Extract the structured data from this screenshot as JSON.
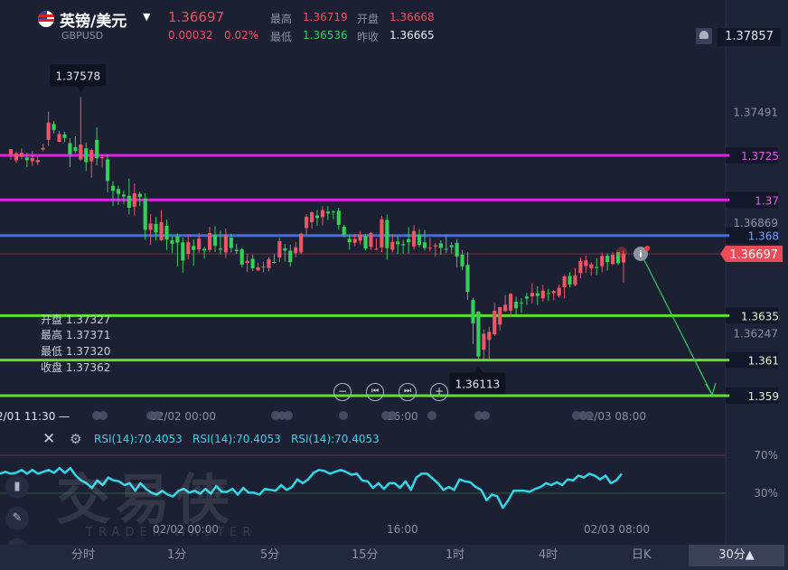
{
  "header": {
    "title": "英镑/美元",
    "symbol": "GBPUSD",
    "price": "1.36697",
    "change": "0.00032",
    "change_pct": "0.02%",
    "stats": {
      "high_label": "最高",
      "high": "1.36719",
      "open_label": "开盘",
      "open": "1.36668",
      "low_label": "最低",
      "low": "1.36536",
      "prev_label": "昨收",
      "prev": "1.36665"
    },
    "right_price": "1.37857"
  },
  "hover": {
    "open": "开盘 1.37327",
    "high": "最高 1.37371",
    "low": "最低 1.37320",
    "close": "收盘 1.37362"
  },
  "nav": {
    "zoom_out": "−",
    "prev": "⏮",
    "next": "⏭",
    "zoom_in": "+"
  },
  "rsi_labels": [
    "RSI(14):70.4053",
    "RSI(14):70.4053",
    "RSI(14):70.4053"
  ],
  "watermark": {
    "cn": "交易侠",
    "en": "TRADER MASTER"
  },
  "timeframes": [
    "分时",
    "1分",
    "5分",
    "15分",
    "1时",
    "4时",
    "日K"
  ],
  "timeframe_selected": "30分▲",
  "icons": {
    "header": [
      "uk-flag-icon",
      "caret-down-icon",
      "bell-icon"
    ],
    "rsi": [
      "close-icon",
      "gear-icon"
    ],
    "side": [
      "candles-icon",
      "pencil-icon",
      "waves-icon"
    ]
  },
  "colors": {
    "up": "#ef5566",
    "down": "#2fd256",
    "magenta": "#e21fe6",
    "blue": "#3a6ff0",
    "green": "#5ee02b",
    "rsi": "#2fd7e8"
  },
  "chart_data": {
    "type": "candlestick",
    "y_axis_ticks": [
      "1.37491",
      "1.36869",
      "1.36247"
    ],
    "y_range": [
      1.3589,
      1.3792
    ],
    "last_price": "1.36697",
    "max_label": "1.37578",
    "min_label": "1.36113",
    "levels": [
      {
        "value": 1.3725,
        "label": "1.3725",
        "color": "magenta"
      },
      {
        "value": 1.37,
        "label": "1.37",
        "color": "magenta"
      },
      {
        "value": 1.368,
        "label": "1.368",
        "color": "blue"
      },
      {
        "value": 1.3635,
        "label": "1.3635",
        "color": "green"
      },
      {
        "value": 1.361,
        "label": "1.361",
        "color": "green"
      },
      {
        "value": 1.359,
        "label": "1.359",
        "color": "green"
      }
    ],
    "x_labels": [
      "2/01 11:30 —",
      "02/02 00:00",
      "16:00",
      "02/03 08:00"
    ],
    "rsi": {
      "levels": [
        "70%",
        "30%"
      ],
      "x_labels": [
        "02/02 00:00",
        "16:00",
        "02/03 08:00"
      ],
      "values": [
        62,
        64,
        62,
        63,
        66,
        62,
        66,
        62,
        64,
        66,
        63,
        68,
        63,
        68,
        60,
        55,
        52,
        47,
        55,
        50,
        58,
        55,
        54,
        50,
        52,
        44,
        52,
        46,
        42,
        40,
        44,
        40,
        38,
        44,
        46,
        42,
        44,
        41,
        46,
        41,
        49,
        43,
        43,
        46,
        40,
        47,
        42,
        42,
        40,
        46,
        45,
        44,
        50,
        45,
        48,
        56,
        52,
        56,
        63,
        66,
        65,
        62,
        64,
        66,
        64,
        61,
        62,
        55,
        54,
        47,
        52,
        46,
        52,
        52,
        47,
        54,
        45,
        58,
        62,
        62,
        57,
        52,
        45,
        48,
        45,
        56,
        54,
        53,
        48,
        45,
        34,
        40,
        38,
        26,
        34,
        44,
        44,
        44,
        43,
        46,
        48,
        52,
        50,
        53,
        50,
        56,
        55,
        60,
        58,
        62,
        60,
        56,
        60,
        52,
        55,
        62
      ]
    },
    "candles": [
      [
        1.37254,
        1.37285,
        1.37246,
        1.37227
      ],
      [
        1.37222,
        1.37262,
        1.37271,
        1.37206
      ],
      [
        1.37242,
        1.37264,
        1.37289,
        1.37229
      ],
      [
        1.37238,
        1.37223,
        1.37265,
        1.37184
      ],
      [
        1.37217,
        1.37235,
        1.37274,
        1.37191
      ],
      [
        1.37212,
        1.37224,
        1.37248,
        1.37196
      ],
      [
        1.37283,
        1.37292,
        1.37316,
        1.37274
      ],
      [
        1.37337,
        1.37434,
        1.37495,
        1.37303
      ],
      [
        1.37426,
        1.37393,
        1.37444,
        1.37373
      ],
      [
        1.37326,
        1.3737,
        1.37387,
        1.37324
      ],
      [
        1.37368,
        1.37348,
        1.37384,
        1.37325
      ],
      [
        1.37319,
        1.37256,
        1.37346,
        1.37185
      ],
      [
        1.37296,
        1.37276,
        1.37357,
        1.37262
      ],
      [
        1.37227,
        1.37311,
        1.37578,
        1.37219
      ],
      [
        1.3729,
        1.37212,
        1.37323,
        1.37162
      ],
      [
        1.37216,
        1.3728,
        1.37289,
        1.37124
      ],
      [
        1.37337,
        1.37234,
        1.37407,
        1.37193
      ],
      [
        1.37238,
        1.37239,
        1.37253,
        1.37182
      ],
      [
        1.37228,
        1.37107,
        1.37255,
        1.37042
      ],
      [
        1.37079,
        1.37051,
        1.37104,
        1.36965
      ],
      [
        1.37061,
        1.37034,
        1.3708,
        1.36972
      ],
      [
        1.3703,
        1.37019,
        1.37052,
        1.36975
      ],
      [
        1.37023,
        1.36956,
        1.3712,
        1.36918
      ],
      [
        1.36962,
        1.37037,
        1.37093,
        1.36913
      ],
      [
        1.37034,
        1.37016,
        1.37046,
        1.36966
      ],
      [
        1.37008,
        1.36832,
        1.37039,
        1.36776
      ],
      [
        1.36832,
        1.36867,
        1.36921,
        1.36748
      ],
      [
        1.36865,
        1.36817,
        1.36904,
        1.36772
      ],
      [
        1.36774,
        1.36875,
        1.36944,
        1.3677
      ],
      [
        1.36855,
        1.36778,
        1.3689,
        1.36719
      ],
      [
        1.36772,
        1.36754,
        1.36796,
        1.36701
      ],
      [
        1.36796,
        1.3676,
        1.36811,
        1.36627
      ],
      [
        1.36761,
        1.36659,
        1.36787,
        1.36591
      ],
      [
        1.36697,
        1.36762,
        1.36805,
        1.36666
      ],
      [
        1.36741,
        1.36719,
        1.36778,
        1.3663
      ],
      [
        1.36721,
        1.36783,
        1.36814,
        1.36702
      ],
      [
        1.36725,
        1.36716,
        1.36736,
        1.36672
      ],
      [
        1.36719,
        1.36813,
        1.36848,
        1.36706
      ],
      [
        1.36802,
        1.36742,
        1.36851,
        1.36707
      ],
      [
        1.36727,
        1.3672,
        1.36829,
        1.36693
      ],
      [
        1.36705,
        1.36802,
        1.36839,
        1.36673
      ],
      [
        1.36788,
        1.3673,
        1.36811,
        1.36705
      ],
      [
        1.3672,
        1.36712,
        1.36754,
        1.36697
      ],
      [
        1.36722,
        1.36637,
        1.3673,
        1.36621
      ],
      [
        1.36646,
        1.36658,
        1.36698,
        1.36595
      ],
      [
        1.36669,
        1.36616,
        1.36692,
        1.366
      ],
      [
        1.36604,
        1.36621,
        1.36647,
        1.366
      ],
      [
        1.36622,
        1.36626,
        1.36653,
        1.36593
      ],
      [
        1.36617,
        1.36667,
        1.36678,
        1.36598
      ],
      [
        1.36651,
        1.36647,
        1.36695,
        1.36642
      ],
      [
        1.36676,
        1.36768,
        1.36786,
        1.36651
      ],
      [
        1.36728,
        1.36715,
        1.36753,
        1.36653
      ],
      [
        1.36715,
        1.3665,
        1.36748,
        1.36627
      ],
      [
        1.36701,
        1.36734,
        1.36763,
        1.36677
      ],
      [
        1.36705,
        1.3681,
        1.36816,
        1.36695
      ],
      [
        1.36842,
        1.36905,
        1.3692,
        1.36801
      ],
      [
        1.36875,
        1.3693,
        1.36937,
        1.36839
      ],
      [
        1.36912,
        1.36898,
        1.36944,
        1.36855
      ],
      [
        1.36903,
        1.36943,
        1.36965,
        1.36856
      ],
      [
        1.36934,
        1.36923,
        1.36965,
        1.36886
      ],
      [
        1.36934,
        1.36929,
        1.36942,
        1.36891
      ],
      [
        1.36939,
        1.3686,
        1.36956,
        1.36833
      ],
      [
        1.3685,
        1.36804,
        1.36858,
        1.3679
      ],
      [
        1.36781,
        1.36762,
        1.36807,
        1.3672
      ],
      [
        1.36759,
        1.36781,
        1.36809,
        1.36739
      ],
      [
        1.36771,
        1.36804,
        1.36825,
        1.3675
      ],
      [
        1.36798,
        1.36727,
        1.36809,
        1.36716
      ],
      [
        1.36736,
        1.36814,
        1.36819,
        1.36719
      ],
      [
        1.36723,
        1.36725,
        1.36783,
        1.36718
      ],
      [
        1.36733,
        1.36891,
        1.36909,
        1.36707
      ],
      [
        1.36887,
        1.36729,
        1.36918,
        1.36664
      ],
      [
        1.3672,
        1.36764,
        1.36808,
        1.36704
      ],
      [
        1.36766,
        1.36751,
        1.36795,
        1.36697
      ],
      [
        1.36751,
        1.36745,
        1.36774,
        1.36698
      ],
      [
        1.36779,
        1.36762,
        1.36846,
        1.367
      ],
      [
        1.36738,
        1.36825,
        1.36858,
        1.36721
      ],
      [
        1.36804,
        1.36748,
        1.36835,
        1.36732
      ],
      [
        1.36761,
        1.3673,
        1.36831,
        1.36716
      ],
      [
        1.36731,
        1.36732,
        1.36786,
        1.36712
      ],
      [
        1.36738,
        1.36745,
        1.36758,
        1.36681
      ],
      [
        1.36756,
        1.3673,
        1.36773,
        1.36691
      ],
      [
        1.36725,
        1.36722,
        1.36802,
        1.36701
      ],
      [
        1.36745,
        1.36734,
        1.36762,
        1.367
      ],
      [
        1.36759,
        1.36682,
        1.36781,
        1.3662
      ],
      [
        1.36692,
        1.36627,
        1.36718,
        1.36607
      ],
      [
        1.36635,
        1.36484,
        1.36705,
        1.36439
      ],
      [
        1.36438,
        1.36306,
        1.36451,
        1.36191
      ],
      [
        1.36373,
        1.3612,
        1.36374,
        1.36101
      ],
      [
        1.36158,
        1.36248,
        1.36273,
        1.36108
      ],
      [
        1.36214,
        1.36259,
        1.36286,
        1.36104
      ],
      [
        1.36245,
        1.36377,
        1.3642,
        1.36236
      ],
      [
        1.36299,
        1.36398,
        1.36398,
        1.36266
      ],
      [
        1.36375,
        1.36411,
        1.36466,
        1.36369
      ],
      [
        1.36378,
        1.36472,
        1.36478,
        1.3634
      ],
      [
        1.36428,
        1.36391,
        1.36457,
        1.36356
      ],
      [
        1.36424,
        1.3642,
        1.36447,
        1.36367
      ],
      [
        1.36457,
        1.36446,
        1.36478,
        1.36409
      ],
      [
        1.36458,
        1.36478,
        1.36532,
        1.36418
      ],
      [
        1.36475,
        1.3646,
        1.36514,
        1.36409
      ],
      [
        1.36447,
        1.3649,
        1.36522,
        1.3643
      ],
      [
        1.36477,
        1.36472,
        1.365,
        1.36432
      ],
      [
        1.36476,
        1.36488,
        1.36493,
        1.36436
      ],
      [
        1.36461,
        1.36506,
        1.36523,
        1.36451
      ],
      [
        1.36509,
        1.3657,
        1.3658,
        1.36446
      ],
      [
        1.36572,
        1.36525,
        1.36595,
        1.36509
      ],
      [
        1.36522,
        1.36576,
        1.36617,
        1.36515
      ],
      [
        1.36589,
        1.36656,
        1.36676,
        1.36559
      ],
      [
        1.36629,
        1.3666,
        1.36688,
        1.3659
      ],
      [
        1.36616,
        1.36638,
        1.3665,
        1.36577
      ],
      [
        1.36623,
        1.36622,
        1.36673,
        1.36578
      ],
      [
        1.36628,
        1.36685,
        1.36703,
        1.36593
      ],
      [
        1.36686,
        1.3665,
        1.367,
        1.36603
      ],
      [
        1.3664,
        1.36691,
        1.36704,
        1.36634
      ],
      [
        1.36706,
        1.36644,
        1.36708,
        1.36634
      ],
      [
        1.36648,
        1.36697,
        1.36719,
        1.36536
      ]
    ]
  }
}
